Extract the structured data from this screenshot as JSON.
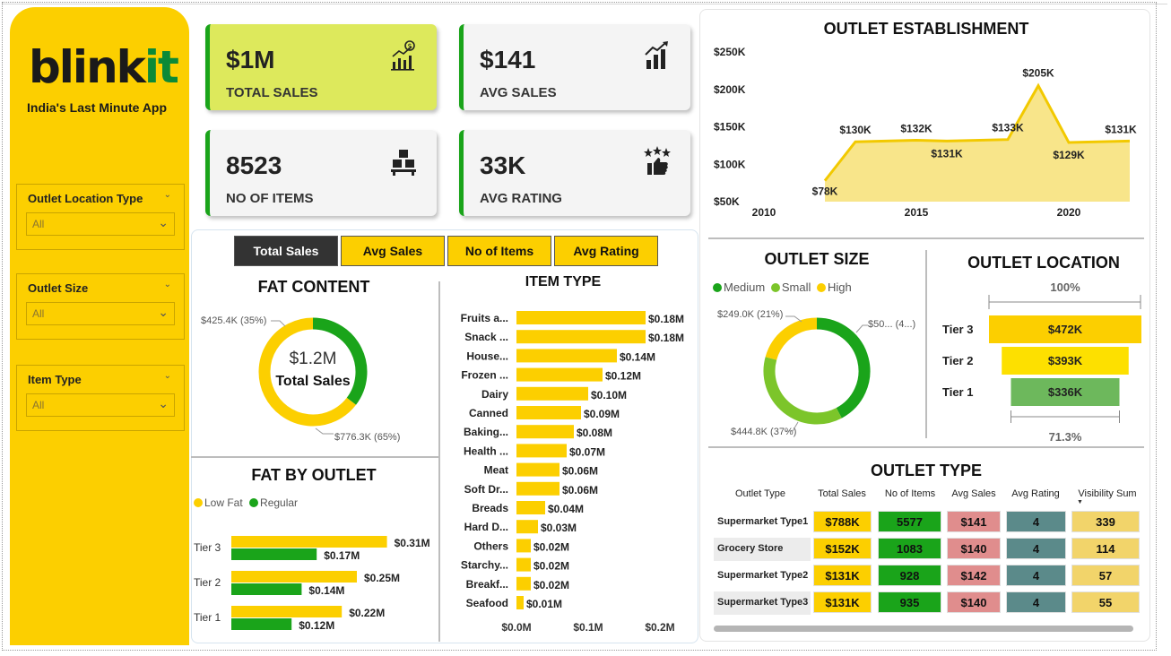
{
  "brand": {
    "name_part1": "blink",
    "name_part2": "it",
    "tagline": "India's Last Minute App"
  },
  "filters": [
    {
      "title": "Outlet Location Type",
      "value": "All"
    },
    {
      "title": "Outlet Size",
      "value": "All"
    },
    {
      "title": "Item Type",
      "value": "All"
    }
  ],
  "kpis": [
    {
      "value": "$1M",
      "label": "TOTAL SALES",
      "icon": "bar-chart-dollar-icon"
    },
    {
      "value": "$141",
      "label": "AVG SALES",
      "icon": "growth-chart-icon"
    },
    {
      "value": "8523",
      "label": "NO OF ITEMS",
      "icon": "boxes-icon"
    },
    {
      "value": "33K",
      "label": "AVG RATING",
      "icon": "thumbs-up-stars-icon"
    }
  ],
  "metric_tabs": [
    "Total Sales",
    "Avg Sales",
    "No of Items",
    "Avg Rating"
  ],
  "colors": {
    "yellow": "#fccf00",
    "green": "#1aa41a",
    "lightgreen": "#7cc52a",
    "dark": "#333333"
  },
  "fat_content": {
    "title": "FAT CONTENT",
    "center_value": "$1.2M",
    "center_label": "Total Sales",
    "label_low": "$425.4K (35%)",
    "label_high": "$776.3K (65%)"
  },
  "fat_by_outlet": {
    "title": "FAT BY OUTLET",
    "legend": [
      "Low Fat",
      "Regular"
    ],
    "rows": [
      {
        "tier": "Tier 3",
        "low": "$0.31M",
        "reg": "$0.17M"
      },
      {
        "tier": "Tier 2",
        "low": "$0.25M",
        "reg": "$0.14M"
      },
      {
        "tier": "Tier 1",
        "low": "$0.22M",
        "reg": "$0.12M"
      }
    ]
  },
  "item_type": {
    "title": "ITEM TYPE",
    "axis": [
      "$0.0M",
      "$0.1M",
      "$0.2M"
    ]
  },
  "outlet_establishment": {
    "title": "OUTLET ESTABLISHMENT",
    "x_ticks": [
      "2010",
      "2015",
      "2020"
    ],
    "y_ticks": [
      "$250K",
      "$200K",
      "$150K",
      "$100K",
      "$50K"
    ]
  },
  "outlet_size": {
    "title": "OUTLET SIZE",
    "legend": [
      "Medium",
      "Small",
      "High"
    ],
    "label_high": "$249.0K (21%)",
    "label_medium": "$50... (4...)",
    "label_small": "$444.8K (37%)"
  },
  "outlet_location": {
    "title": "OUTLET LOCATION",
    "top_pct": "100%",
    "bottom_pct": "71.3%",
    "rows": [
      {
        "tier": "Tier 3",
        "value": "$472K"
      },
      {
        "tier": "Tier 2",
        "value": "$393K"
      },
      {
        "tier": "Tier 1",
        "value": "$336K"
      }
    ]
  },
  "outlet_type": {
    "title": "OUTLET TYPE",
    "headers": [
      "Outlet Type",
      "Total Sales",
      "No of Items",
      "Avg Sales",
      "Avg Rating",
      "Visibility Sum"
    ],
    "rows": [
      {
        "type": "Supermarket Type1",
        "sales": "$788K",
        "items": "5577",
        "avg": "$141",
        "rating": "4",
        "vis": "339"
      },
      {
        "type": "Grocery Store",
        "sales": "$152K",
        "items": "1083",
        "avg": "$140",
        "rating": "4",
        "vis": "114"
      },
      {
        "type": "Supermarket Type2",
        "sales": "$131K",
        "items": "928",
        "avg": "$142",
        "rating": "4",
        "vis": "57"
      },
      {
        "type": "Supermarket Type3",
        "sales": "$131K",
        "items": "935",
        "avg": "$140",
        "rating": "4",
        "vis": "55"
      }
    ]
  },
  "chart_data": [
    {
      "type": "pie",
      "title": "FAT CONTENT",
      "categories": [
        "Low Fat",
        "Regular"
      ],
      "values": [
        776.3,
        425.4
      ],
      "unit": "$K"
    },
    {
      "type": "bar",
      "title": "FAT BY OUTLET",
      "categories": [
        "Tier 3",
        "Tier 2",
        "Tier 1"
      ],
      "series": [
        {
          "name": "Low Fat",
          "values": [
            0.31,
            0.25,
            0.22
          ]
        },
        {
          "name": "Regular",
          "values": [
            0.17,
            0.14,
            0.12
          ]
        }
      ]
    },
    {
      "type": "bar",
      "title": "ITEM TYPE",
      "categories": [
        "Fruits a...",
        "Snack ...",
        "House...",
        "Frozen ...",
        "Dairy",
        "Canned",
        "Baking...",
        "Health ...",
        "Meat",
        "Soft Dr...",
        "Breads",
        "Hard D...",
        "Others",
        "Starchy...",
        "Breakf...",
        "Seafood"
      ],
      "values": [
        0.18,
        0.18,
        0.14,
        0.12,
        0.1,
        0.09,
        0.08,
        0.07,
        0.06,
        0.06,
        0.04,
        0.03,
        0.02,
        0.02,
        0.02,
        0.01
      ],
      "labels": [
        "$0.18M",
        "$0.18M",
        "$0.14M",
        "$0.12M",
        "$0.10M",
        "$0.09M",
        "$0.08M",
        "$0.07M",
        "$0.06M",
        "$0.06M",
        "$0.04M",
        "$0.03M",
        "$0.02M",
        "$0.02M",
        "$0.02M",
        "$0.01M"
      ],
      "xlim": [
        0,
        0.2
      ]
    },
    {
      "type": "area",
      "title": "OUTLET ESTABLISHMENT",
      "x": [
        2012,
        2013,
        2015,
        2016,
        2018,
        2019,
        2020,
        2022
      ],
      "values": [
        78,
        130,
        132,
        131,
        133,
        205,
        129,
        131
      ],
      "labels": [
        "$78K",
        "$130K",
        "$132K",
        "$131K",
        "$133K",
        "$205K",
        "$129K",
        "$131K"
      ],
      "ylim": [
        50,
        250
      ],
      "xlim": [
        2010,
        2022
      ]
    },
    {
      "type": "pie",
      "title": "OUTLET SIZE",
      "categories": [
        "Medium",
        "Small",
        "High"
      ],
      "values": [
        507.9,
        444.8,
        249.0
      ],
      "unit": "$K"
    },
    {
      "type": "bar",
      "title": "OUTLET LOCATION",
      "categories": [
        "Tier 3",
        "Tier 2",
        "Tier 1"
      ],
      "values": [
        472,
        393,
        336
      ],
      "unit": "$K"
    }
  ]
}
